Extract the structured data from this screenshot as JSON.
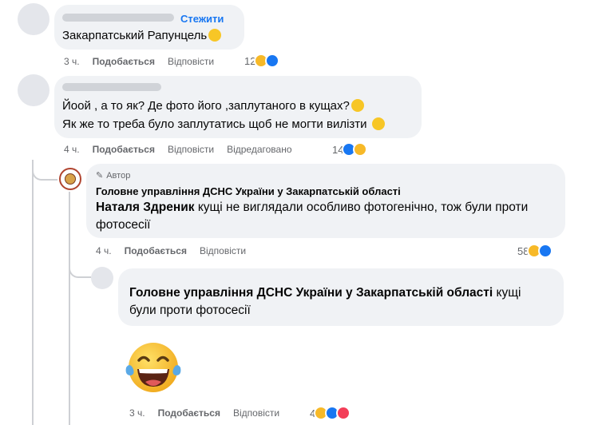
{
  "comments": [
    {
      "follow_label": "Стежити",
      "text": "Закарпатський Рапунцель",
      "time": "3 ч.",
      "like_label": "Подобається",
      "reply_label": "Відповісти",
      "reaction_count": "12",
      "reactions": [
        "haha-icon",
        "like-icon"
      ]
    },
    {
      "line1": "Йоой , а то як? Де фото його ,заплутаного в кущах?",
      "line2": "Як же то треба було заплутатись щоб не могти вилізти",
      "time": "4 ч.",
      "like_label": "Подобається",
      "reply_label": "Відповісти",
      "edited_label": "Відредаговано",
      "reaction_count": "14",
      "reactions": [
        "like-icon",
        "haha-icon"
      ]
    }
  ],
  "author_reply": {
    "badge": "Автор",
    "page_name": "Головне управління ДСНС України у Закарпатській області",
    "mention": "Наталя Здреник",
    "line1_rest": " кущі не виглядали особливо фотогенічно, тож були проти",
    "line2": "фотосесії",
    "time": "4 ч.",
    "like_label": "Подобається",
    "reply_label": "Відповісти",
    "reaction_count": "58",
    "reactions": [
      "haha-icon",
      "like-icon"
    ]
  },
  "nested_reply": {
    "mention": "Головне управління ДСНС України у Закарпатській області",
    "rest": " кущі",
    "line2": "були проти фотосесії",
    "sticker": "laughing-tears-emoji",
    "time": "3 ч.",
    "like_label": "Подобається",
    "reply_label": "Відповісти",
    "reaction_count": "4",
    "reactions": [
      "haha-icon",
      "like-icon",
      "love-icon"
    ]
  },
  "colors": {
    "link": "#1877f2",
    "bubble": "#f0f2f5",
    "meta": "#65676b",
    "like": "#1877f2",
    "haha": "#f7b928",
    "love": "#f33e58"
  }
}
